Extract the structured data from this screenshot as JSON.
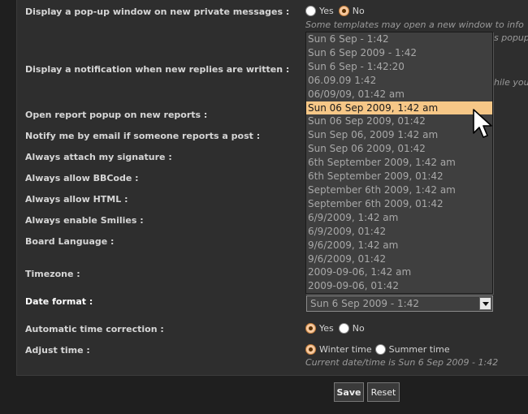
{
  "rows": {
    "popup_pm": {
      "label": "Display a pop-up window on new private messages :",
      "yes": "Yes",
      "no": "No"
    },
    "popup_hint": [
      "Some templates may open a new window to info",
      "s popup"
    ],
    "notify_replies": {
      "label": "Display a notification when new replies are written :"
    },
    "notify_hint": "hile you",
    "report_popup": {
      "label": "Open report popup on new reports :"
    },
    "notify_email": {
      "label": "Notify me by email if someone reports a post :"
    },
    "attach_sig": {
      "label": "Always attach my signature :"
    },
    "allow_bbcode": {
      "label": "Always allow BBCode :"
    },
    "allow_html": {
      "label": "Always allow HTML :"
    },
    "enable_smilies": {
      "label": "Always enable Smilies :"
    },
    "board_language": {
      "label": "Board Language :"
    },
    "timezone": {
      "label": "Timezone :"
    },
    "date_format": {
      "label": "Date format :"
    },
    "auto_time": {
      "label": "Automatic time correction :",
      "yes": "Yes",
      "no": "No"
    },
    "adjust_time": {
      "label": "Adjust time :",
      "winter": "Winter time",
      "summer": "Summer time"
    },
    "current_time": "Current date/time is Sun 6 Sep 2009 - 1:42"
  },
  "date_format_options": [
    "Sun 6 Sep - 1:42",
    "Sun 6 Sep 2009 - 1:42",
    "Sun 6 Sep - 1:42:20",
    "06.09.09 1:42",
    "06/09/09, 01:42 am",
    "Sun 06 Sep 2009, 1:42 am",
    "Sun 06 Sep 2009, 01:42",
    "Sun Sep 06, 2009 1:42 am",
    "Sun Sep 06 2009, 01:42",
    "6th September 2009, 1:42 am",
    "6th September 2009, 01:42",
    "September 6th 2009, 1:42 am",
    "September 6th 2009, 01:42",
    "6/9/2009, 1:42 am",
    "6/9/2009, 01:42",
    "9/6/2009, 1:42 am",
    "9/6/2009, 01:42",
    "2009-09-06, 1:42 am",
    "2009-09-06, 01:42"
  ],
  "date_format_highlighted": "Sun 06 Sep 2009, 1:42 am",
  "date_format_selected": "Sun 6 Sep 2009 - 1:42",
  "buttons": {
    "save": "Save",
    "reset": "Reset"
  },
  "colors": {
    "highlight": "#f6c787",
    "panel": "#2e2e2e",
    "background": "#1f1f1f"
  }
}
